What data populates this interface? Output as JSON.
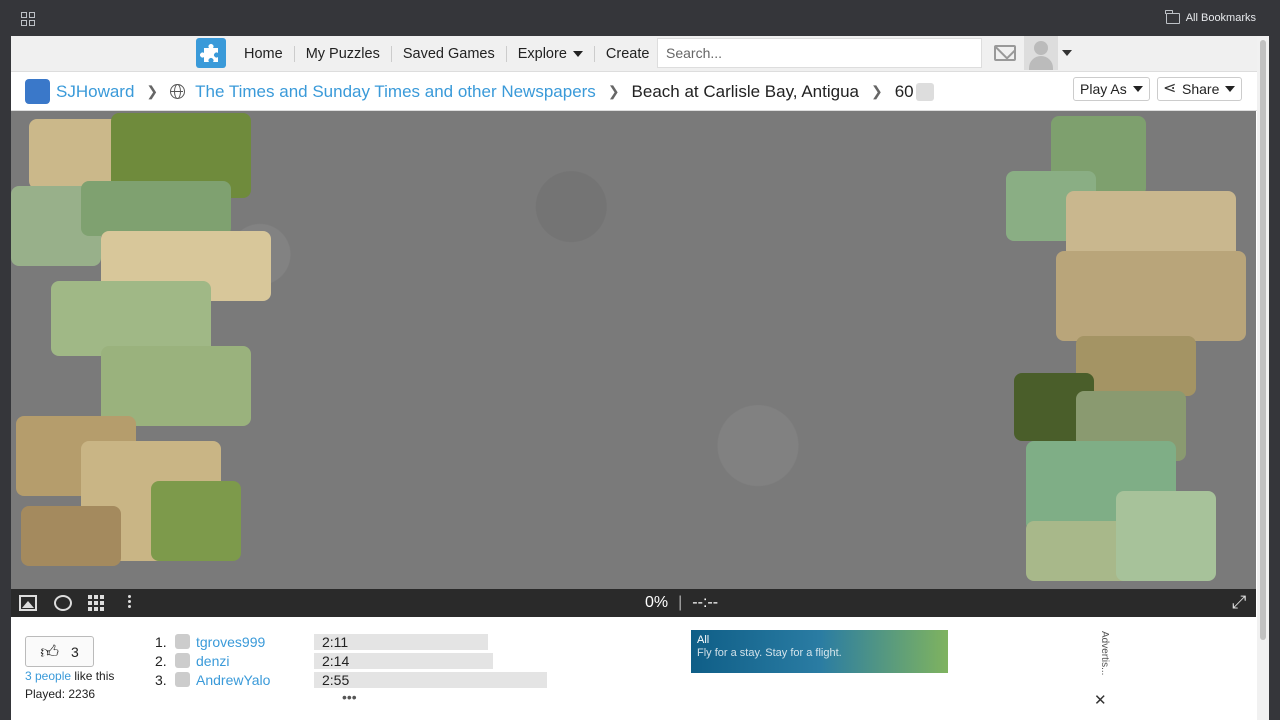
{
  "browser": {
    "bookmarks_label": "All Bookmarks"
  },
  "nav": {
    "links": [
      "Home",
      "My Puzzles",
      "Saved Games",
      "Explore",
      "Create"
    ],
    "search_placeholder": "Search..."
  },
  "breadcrumb": {
    "user": "SJHoward",
    "collection": "The Times and Sunday Times and other Newspapers",
    "puzzle_title": "Beach at Carlisle Bay, Antigua",
    "pieces": "60",
    "play_as_label": "Play As",
    "share_label": "Share"
  },
  "board": {
    "progress": "0%",
    "timer": "--:--",
    "background_color": "#7a7a7a"
  },
  "footer": {
    "like_count": "3",
    "likes_link": "3 people",
    "likes_suffix": " like this",
    "played": "Played: 2236",
    "scores": [
      {
        "rank": "1.",
        "name": "tgroves999",
        "time": "2:11"
      },
      {
        "rank": "2.",
        "name": "denzi",
        "time": "2:14"
      },
      {
        "rank": "3.",
        "name": "AndrewYalo",
        "time": "2:55"
      }
    ],
    "more": "•••",
    "ad_text": "Fly for a stay. Stay for a flight.",
    "ad_tag": "All",
    "ad_label": "Advertis...",
    "ad_close": "✕"
  }
}
